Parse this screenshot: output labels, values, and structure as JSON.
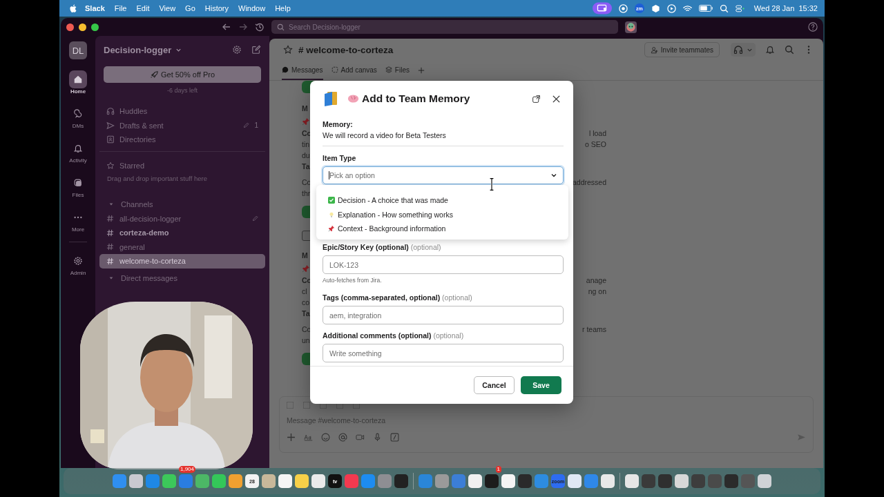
{
  "menubar": {
    "app_name": "Slack",
    "menus": [
      "File",
      "Edit",
      "View",
      "Go",
      "History",
      "Window",
      "Help"
    ],
    "zoom_label": "zm",
    "clock": "Wed 28 Jan  15:32"
  },
  "window": {
    "search_placeholder": "Search Decision-logger"
  },
  "rail": {
    "avatar": "DL",
    "items": [
      {
        "label": "Home",
        "selected": true
      },
      {
        "label": "DMs",
        "selected": false
      },
      {
        "label": "Activity",
        "selected": false
      },
      {
        "label": "Files",
        "selected": false
      },
      {
        "label": "More",
        "selected": false
      },
      {
        "label": "Admin",
        "selected": false
      }
    ]
  },
  "sidebar": {
    "workspace": "Decision-logger",
    "promo": "Get 50% off Pro",
    "promo_note": "-6 days left",
    "nav": [
      {
        "label": "Huddles"
      },
      {
        "label": "Drafts & sent",
        "count": "1"
      },
      {
        "label": "Directories"
      }
    ],
    "starred": {
      "title": "Starred",
      "hint": "Drag and drop important stuff here"
    },
    "channels": {
      "title": "Channels",
      "items": [
        {
          "name": "all-decision-logger",
          "unread": false,
          "selected": false
        },
        {
          "name": "corteza-demo",
          "unread": true,
          "selected": false
        },
        {
          "name": "general",
          "unread": false,
          "selected": false
        },
        {
          "name": "welcome-to-corteza",
          "unread": false,
          "selected": true
        }
      ]
    },
    "dms_title": "Direct messages"
  },
  "main": {
    "title": "# welcome-to-corteza",
    "invite": "Invite teammates",
    "tabs": [
      {
        "label": "Messages",
        "selected": true
      },
      {
        "label": "Add canvas",
        "selected": false
      },
      {
        "label": "Files",
        "selected": false
      }
    ],
    "rows": [
      {
        "kind": "reaction"
      },
      {
        "kind": "author",
        "left": "M"
      },
      {
        "kind": "pin"
      },
      {
        "kind": "bold",
        "left": "Co",
        "right": "l load"
      },
      {
        "kind": "line",
        "left": "tin",
        "right": "o SEO"
      },
      {
        "kind": "line",
        "left": "du"
      },
      {
        "kind": "bold",
        "left": "Ta"
      },
      {
        "kind": "para",
        "left": "Co",
        "right": "addressed"
      },
      {
        "kind": "line",
        "left": "thr"
      },
      {
        "kind": "reaction"
      },
      {
        "kind": "checkbox",
        "checked": false
      },
      {
        "kind": "author",
        "left": "M"
      },
      {
        "kind": "pin"
      },
      {
        "kind": "bold",
        "left": "Co",
        "right": "anage"
      },
      {
        "kind": "line",
        "left": "cl",
        "right": "ng on"
      },
      {
        "kind": "line",
        "left": "co"
      },
      {
        "kind": "bold",
        "left": "Ta"
      },
      {
        "kind": "para",
        "left": "Co",
        "right": "r teams"
      },
      {
        "kind": "line",
        "left": "un"
      },
      {
        "kind": "reaction"
      }
    ],
    "composer_placeholder": "Message #welcome-to-corteza"
  },
  "modal": {
    "title": "Add to Team Memory",
    "memory_label": "Memory:",
    "memory_text": "We will record a video for Beta Testers",
    "item_type_label": "Item Type",
    "select_placeholder": "Pick an option",
    "options": [
      {
        "kind": "check",
        "label": "Decision - A choice that was made"
      },
      {
        "kind": "bulb",
        "label": "Explanation - How something works"
      },
      {
        "kind": "pin",
        "label": "Context - Background information"
      }
    ],
    "fields": [
      {
        "label": "**Epic/Story Key (optional)** (optional)",
        "placeholder": "LOK-123",
        "help": "Auto-fetches from Jira."
      },
      {
        "label": "**Tags (comma-separated, optional)** (optional)",
        "placeholder": "aem, integration"
      },
      {
        "label": "**Additional comments (optional)** (optional)",
        "placeholder": "Write something"
      }
    ],
    "cancel": "Cancel",
    "save": "Save"
  },
  "dock": {
    "groups": [
      [
        {
          "color": "#2f8ff0"
        },
        {
          "color": "#c9c9d0"
        },
        {
          "color": "#1e88e5"
        },
        {
          "color": "#3cc85a"
        },
        {
          "color": "#2a7de1",
          "badge": "1,904"
        },
        {
          "color": "#4cb866"
        },
        {
          "color": "#34c759"
        },
        {
          "color": "#f0a030"
        },
        {
          "color": "#f2f2f2",
          "label": "28"
        },
        {
          "color": "#c8b89a"
        },
        {
          "color": "#f5f5f5"
        },
        {
          "color": "#f7d048"
        },
        {
          "color": "#eaeaea"
        },
        {
          "color": "#111111",
          "label": "tv"
        },
        {
          "color": "#f2394f"
        },
        {
          "color": "#1d8cf0"
        },
        {
          "color": "#8e8e93"
        },
        {
          "color": "#222222"
        }
      ],
      [
        {
          "color": "#2a86d8"
        },
        {
          "color": "#9a9a9a"
        },
        {
          "color": "#3c7ed6"
        },
        {
          "color": "#f0f0f0"
        },
        {
          "color": "#1c1c1c",
          "badge": "1"
        },
        {
          "color": "#f4f4f4"
        },
        {
          "color": "#2a2a2a"
        },
        {
          "color": "#2d8ce0"
        },
        {
          "color": "#2d6cf0",
          "label": "zoom"
        },
        {
          "color": "#dfe8f5"
        },
        {
          "color": "#2f88e8"
        },
        {
          "color": "#e8e8e8"
        }
      ],
      [
        {
          "color": "#e6e6e6"
        },
        {
          "color": "#3a3a3a"
        },
        {
          "color": "#2f2f2f"
        },
        {
          "color": "#d8d8d8"
        },
        {
          "color": "#3d3d3d"
        },
        {
          "color": "#4a4a4a"
        },
        {
          "color": "#2b2b2b"
        },
        {
          "color": "#555555"
        },
        {
          "color": "#cfd2d6"
        }
      ]
    ]
  }
}
